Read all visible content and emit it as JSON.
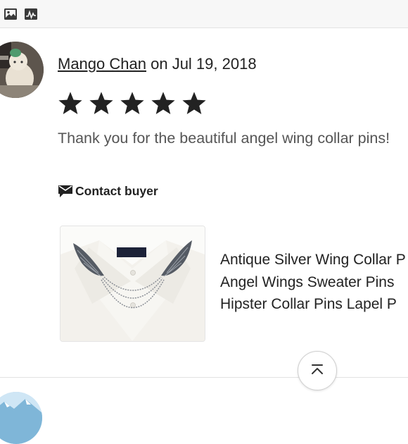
{
  "toolbar": {
    "icons": [
      "image-icon",
      "chart-icon"
    ]
  },
  "review": {
    "author": "Mango Chan",
    "date_text": "on Jul 19, 2018",
    "rating": 5,
    "rating_max": 5,
    "text": "Thank you for the beautiful angel wing collar pins!",
    "contact_label": "Contact buyer"
  },
  "product": {
    "title_lines": [
      "Antique Silver Wing Collar P",
      "Angel Wings Sweater Pins",
      "Hipster Collar Pins Lapel P"
    ]
  },
  "colors": {
    "star": "#222222",
    "text_muted": "#555555"
  }
}
